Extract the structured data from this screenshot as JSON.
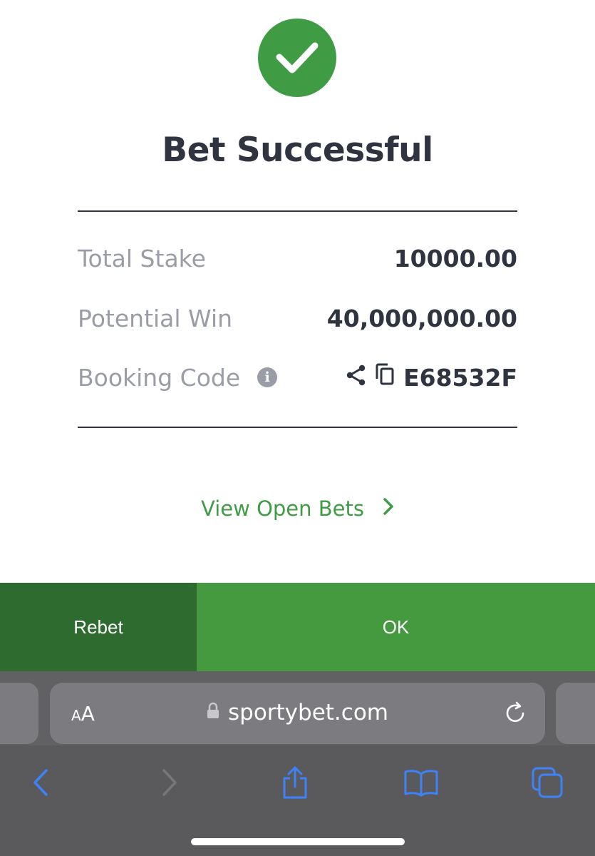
{
  "sheet": {
    "title": "Bet Successful",
    "rows": [
      {
        "label": "Total Stake",
        "value": "10000.00"
      },
      {
        "label": "Potential Win",
        "value": "40,000,000.00"
      },
      {
        "label": "Booking Code",
        "value": "E68532F"
      }
    ],
    "view_open_bets": "View Open Bets"
  },
  "actions": {
    "rebet": "Rebet",
    "ok": "OK"
  },
  "browser": {
    "text_size": "AA",
    "url": "sportybet.com"
  },
  "colors": {
    "accent": "#3f9c45",
    "rebet_bg": "#2d6b2f",
    "ok_bg": "#45993f",
    "text_dark": "#2f3440",
    "text_muted": "#9a9ca6",
    "ios_blue": "#3d82f6"
  },
  "icons": [
    "checkmark-icon",
    "info-icon",
    "share-icon",
    "copy-icon",
    "chevron-right-icon",
    "lock-icon",
    "reload-icon",
    "back-icon",
    "forward-icon",
    "share-sheet-icon",
    "bookmarks-icon",
    "tabs-icon"
  ]
}
